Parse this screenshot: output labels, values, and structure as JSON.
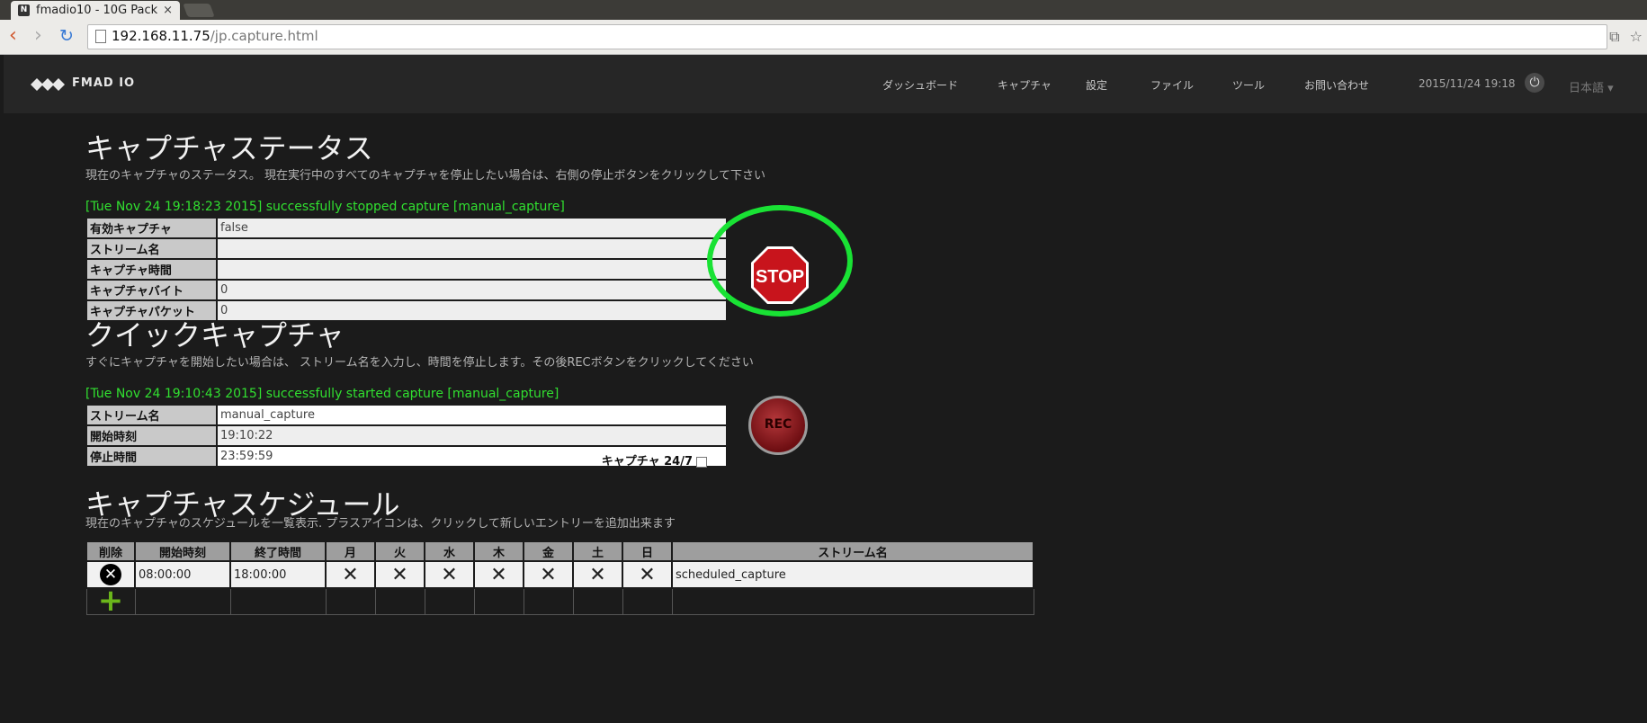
{
  "browser": {
    "tab_favicon": "N",
    "tab_title": "fmadio10 - 10G Pack",
    "tab_close": "×",
    "url_host": "192.168.11.75",
    "url_path": "/jp.capture.html",
    "back_icon": "‹",
    "forward_icon": "›",
    "reload_icon": "↻",
    "star_icon": "☆",
    "translate_icon": "⧉"
  },
  "header": {
    "logo_text": "FMAD IO",
    "nav": [
      "ダッシュボード",
      "キャプチャ",
      "設定",
      "ファイル",
      "ツール",
      "お問い合わせ"
    ],
    "datetime": "2015/11/24 19:18",
    "power_icon": "⏻",
    "language": "日本語 ▾"
  },
  "capture_status": {
    "title": "キャプチャステータス",
    "description": "現在のキャプチャのステータス。 現在実行中のすべてのキャプチャを停止したい場合は、右側の停止ボタンをクリックして下さい",
    "message": "[Tue Nov 24 19:18:23 2015] successfully stopped capture [manual_capture]",
    "rows": [
      {
        "label": "有効キャプチャ",
        "value": "false"
      },
      {
        "label": "ストリーム名",
        "value": ""
      },
      {
        "label": "キャプチャ時間",
        "value": ""
      },
      {
        "label": "キャプチャバイト",
        "value": "0"
      },
      {
        "label": "キャプチャパケット",
        "value": "0"
      }
    ],
    "stop_label": "STOP"
  },
  "quick_capture": {
    "title": "クイックキャプチャ",
    "description": "すぐにキャプチャを開始したい場合は、 ストリーム名を入力し、時間を停止します。その後RECボタンをクリックしてください",
    "message": "[Tue Nov 24 19:10:43 2015] successfully started capture [manual_capture]",
    "stream_label": "ストリーム名",
    "stream_value": "manual_capture",
    "start_label": "開始時刻",
    "start_value": "19:10:22",
    "stop_label": "停止時間",
    "stop_value": "23:59:59",
    "capture247_label": "キャプチャ 24/7",
    "rec_label": "REC"
  },
  "schedule": {
    "title": "キャプチャスケジュール",
    "description": "現在のキャプチャのスケジュールを一覧表示. プラスアイコンは、クリックして新しいエントリーを追加出来ます",
    "headers": [
      "削除",
      "開始時刻",
      "終了時間",
      "月",
      "火",
      "水",
      "木",
      "金",
      "土",
      "日",
      "ストリーム名"
    ],
    "rows": [
      {
        "start": "08:00:00",
        "end": "18:00:00",
        "days": [
          "✕",
          "✕",
          "✕",
          "✕",
          "✕",
          "✕",
          "✕"
        ],
        "stream": "scheduled_capture"
      }
    ],
    "delete_icon": "✕",
    "add_icon": "+"
  },
  "colors": {
    "status_green": "#31e030",
    "highlight_ring": "#19e234",
    "stop_red": "#c8141c",
    "plus_green": "#6bb61b"
  }
}
